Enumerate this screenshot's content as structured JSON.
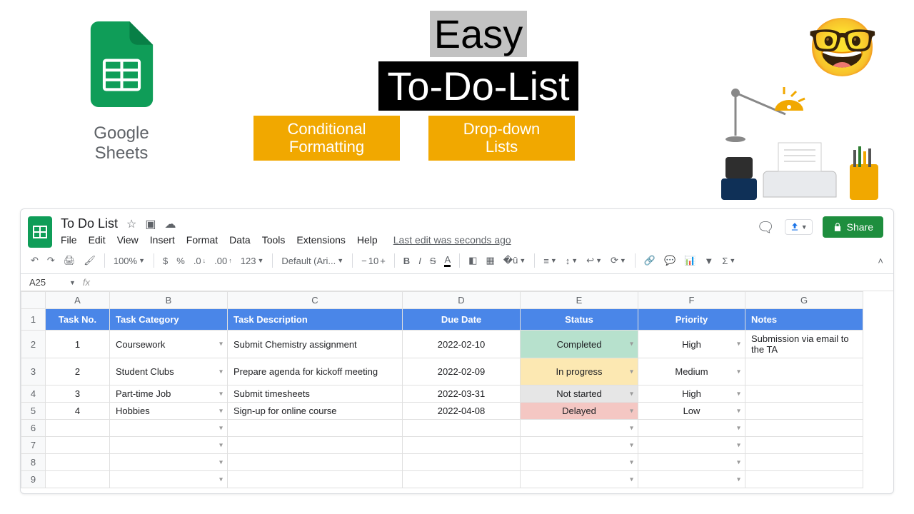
{
  "hero": {
    "brand_text": "Google Sheets",
    "title_line1": "Easy",
    "title_line2": "To-Do-List",
    "pill1_line1": "Conditional",
    "pill1_line2": "Formatting",
    "pill2_line1": "Drop-down",
    "pill2_line2": "Lists",
    "emoji": "🤓"
  },
  "window": {
    "doc_title": "To Do List",
    "menus": [
      "File",
      "Edit",
      "View",
      "Insert",
      "Format",
      "Data",
      "Tools",
      "Extensions",
      "Help"
    ],
    "last_edit": "Last edit was seconds ago",
    "share_label": "Share",
    "toolbar": {
      "zoom": "100%",
      "currency": "$",
      "percent": "%",
      "dec_dec": ".0",
      "dec_inc": ".00",
      "numfmt": "123",
      "font": "Default (Ari...",
      "size": "10"
    },
    "namebox": "A25"
  },
  "grid": {
    "col_letters": [
      "A",
      "B",
      "C",
      "D",
      "E",
      "F",
      "G"
    ],
    "headers": [
      "Task No.",
      "Task Category",
      "Task Description",
      "Due Date",
      "Status",
      "Priority",
      "Notes"
    ],
    "rows": [
      {
        "no": "1",
        "cat": "Coursework",
        "desc": "Submit Chemistry assignment",
        "due": "2022-02-10",
        "status": "Completed",
        "status_class": "completed",
        "prio": "High",
        "notes": "Submission via email to the TA",
        "tall": true
      },
      {
        "no": "2",
        "cat": "Student Clubs",
        "desc": "Prepare agenda for kickoff meeting",
        "due": "2022-02-09",
        "status": "In progress",
        "status_class": "inprogress",
        "prio": "Medium",
        "notes": "",
        "tall": true
      },
      {
        "no": "3",
        "cat": "Part-time Job",
        "desc": "Submit timesheets",
        "due": "2022-03-31",
        "status": "Not started",
        "status_class": "notstarted",
        "prio": "High",
        "notes": "",
        "tall": false
      },
      {
        "no": "4",
        "cat": "Hobbies",
        "desc": "Sign-up for online course",
        "due": "2022-04-08",
        "status": "Delayed",
        "status_class": "delayed",
        "prio": "Low",
        "notes": "",
        "tall": false
      }
    ],
    "empty_row_count": 4
  }
}
